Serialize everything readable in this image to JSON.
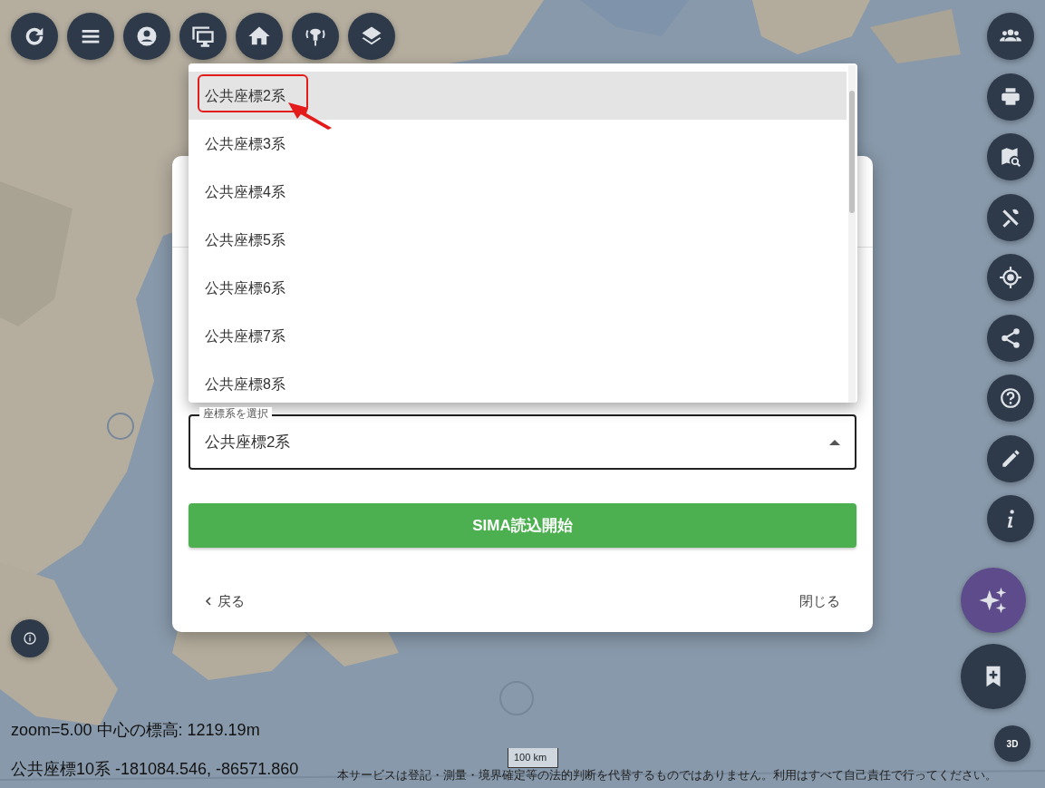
{
  "dialog": {
    "field_label": "座標系を選択",
    "field_value": "公共座標2系",
    "menu_expanded": true,
    "options": [
      {
        "label": "公共座標2系",
        "selected": true,
        "callout": true
      },
      {
        "label": "公共座標3系",
        "selected": false,
        "callout": false
      },
      {
        "label": "公共座標4系",
        "selected": false,
        "callout": false
      },
      {
        "label": "公共座標5系",
        "selected": false,
        "callout": false
      },
      {
        "label": "公共座標6系",
        "selected": false,
        "callout": false
      },
      {
        "label": "公共座標7系",
        "selected": false,
        "callout": false
      },
      {
        "label": "公共座標8系",
        "selected": false,
        "callout": false
      }
    ],
    "submit_button": "SIMA読込開始",
    "back_link": "戻る",
    "close_link": "閉じる"
  },
  "map_overlay": {
    "status_line": "zoom=5.00 中心の標高: 1219.19m",
    "coordinates": "公共座標10系 -181084.546, -86571.860",
    "scale": "100 km",
    "disclaimer": "本サービスは登記・測量・境界確定等の法的判断を代替するものではありません。利用はすべて自己責任で行ってください。"
  },
  "view_3d_button": "3D"
}
